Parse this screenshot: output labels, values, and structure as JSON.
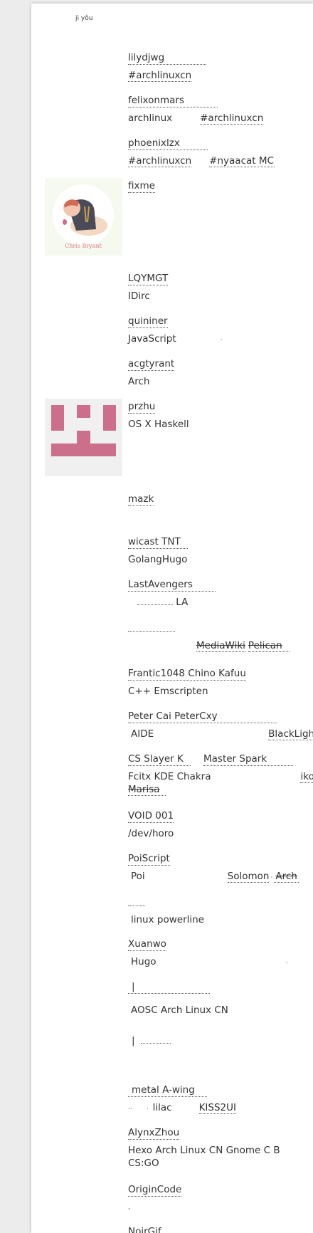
{
  "site": {
    "title": "ji yǒu"
  },
  "friends": [
    {
      "name": "lilydjwg",
      "desc": "#archlinuxcn"
    },
    {
      "name": "felixonmars",
      "desc_a": "archlinux",
      "desc_b": "#archlinuxcn"
    },
    {
      "name": "phoenixlzx",
      "desc_a": "#archlinuxcn",
      "desc_b": "#nyaacat MC"
    },
    {
      "name": "fixme",
      "avatar_caption": "Chris Bryant"
    },
    {
      "name": "LQYMGT",
      "desc": "IDirc"
    },
    {
      "name": "quininer",
      "desc": "JavaScript"
    },
    {
      "name": "acgtyrant",
      "desc": "Arch"
    },
    {
      "name": "przhu",
      "desc": "OS X Haskell"
    },
    {
      "name": "mazk"
    },
    {
      "name": "wicast TNT",
      "desc": "GolangHugo"
    },
    {
      "name": "LastAvengers",
      "desc": "LA"
    },
    {
      "name": "",
      "desc_a": "MediaWiki",
      "desc_b": "Pelican"
    },
    {
      "name": "Frantic1048 Chino Kafuu",
      "desc": "C++  Emscripten"
    },
    {
      "name": "Peter Cai  PeterCxy",
      "desc_a": "AIDE",
      "desc_b": "BlackLight"
    },
    {
      "name_a": "CS Slayer K",
      "name_b": "Master Spark",
      "desc_a": "Fcitx   KDE  Chakra",
      "desc_b": "iko",
      "desc_c": "Marisa"
    },
    {
      "name": "VOID 001",
      "desc": "/dev/horo"
    },
    {
      "name": "PoiScript",
      "desc_a": "Poi",
      "desc_b": "Solomon",
      "desc_c": "Arch"
    },
    {
      "name": "",
      "desc": "linux  powerline"
    },
    {
      "name": "Xuanwo",
      "desc": "Hugo"
    },
    {
      "name": "|",
      "desc": "AOSC  Arch Linux CN"
    },
    {
      "name": "|"
    },
    {
      "name": "metal A-wing",
      "desc_a": "lilac",
      "desc_b": "KISS2UI"
    },
    {
      "name": "AlynxZhou",
      "desc": "Hexo Arch Linux CN  Gnome  C  B",
      "desc_2": "CS:GO"
    },
    {
      "name": "OriginCode",
      "desc": ","
    },
    {
      "name": "NoirGif"
    }
  ]
}
